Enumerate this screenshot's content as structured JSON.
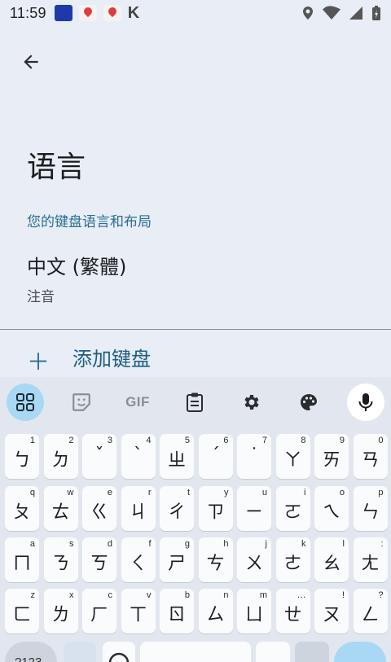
{
  "status": {
    "time": "11:59",
    "brand_letter": "K"
  },
  "page": {
    "title": "语言",
    "section_header": "您的键盘语言和布局",
    "language_name": "中文 (繁體)",
    "language_layout": "注音",
    "add_keyboard_label": "添加键盘"
  },
  "keyboard": {
    "toolbar": {
      "gif_label": "GIF",
      "icons": [
        "apps-grid-icon",
        "sticker-icon",
        "gif-icon",
        "clipboard-icon",
        "settings-gear-icon",
        "palette-icon",
        "microphone-icon"
      ]
    },
    "rows": [
      [
        {
          "main": "ㄅ",
          "hint": "1"
        },
        {
          "main": "ㄉ",
          "hint": "2"
        },
        {
          "main": "ˇ",
          "hint": "3"
        },
        {
          "main": "ˋ",
          "hint": "4"
        },
        {
          "main": "ㄓ",
          "hint": "5"
        },
        {
          "main": "ˊ",
          "hint": "6"
        },
        {
          "main": "˙",
          "hint": "7"
        },
        {
          "main": "ㄚ",
          "hint": "8"
        },
        {
          "main": "ㄞ",
          "hint": "9"
        },
        {
          "main": "ㄢ",
          "hint": "0"
        }
      ],
      [
        {
          "main": "ㄆ",
          "hint": "q"
        },
        {
          "main": "ㄊ",
          "hint": "w"
        },
        {
          "main": "ㄍ",
          "hint": "e"
        },
        {
          "main": "ㄐ",
          "hint": "r"
        },
        {
          "main": "ㄔ",
          "hint": "t"
        },
        {
          "main": "ㄗ",
          "hint": "y"
        },
        {
          "main": "ㄧ",
          "hint": "u"
        },
        {
          "main": "ㄛ",
          "hint": "i"
        },
        {
          "main": "ㄟ",
          "hint": "o"
        },
        {
          "main": "ㄣ",
          "hint": "p"
        }
      ],
      [
        {
          "main": "ㄇ",
          "hint": "a"
        },
        {
          "main": "ㄋ",
          "hint": "s"
        },
        {
          "main": "ㄎ",
          "hint": "d"
        },
        {
          "main": "ㄑ",
          "hint": "f"
        },
        {
          "main": "ㄕ",
          "hint": "g"
        },
        {
          "main": "ㄘ",
          "hint": "h"
        },
        {
          "main": "ㄨ",
          "hint": "j"
        },
        {
          "main": "ㄜ",
          "hint": "k"
        },
        {
          "main": "ㄠ",
          "hint": "l"
        },
        {
          "main": "ㄤ",
          "hint": ":"
        }
      ],
      [
        {
          "main": "ㄈ",
          "hint": "z"
        },
        {
          "main": "ㄌ",
          "hint": "x"
        },
        {
          "main": "ㄏ",
          "hint": "c"
        },
        {
          "main": "ㄒ",
          "hint": "v"
        },
        {
          "main": "ㄖ",
          "hint": "b"
        },
        {
          "main": "ㄙ",
          "hint": "n"
        },
        {
          "main": "ㄩ",
          "hint": "m"
        },
        {
          "main": "ㄝ",
          "hint": "…"
        },
        {
          "main": "ㄡ",
          "hint": "!"
        },
        {
          "main": "ㄥ",
          "hint": "?"
        }
      ]
    ],
    "symbols_key_label": "?123",
    "colors": {
      "accent": "#a8d8f4",
      "key_bg": "#fafbfd",
      "panel_bg": "#e2e7ef",
      "link": "#2a6e8f"
    }
  }
}
